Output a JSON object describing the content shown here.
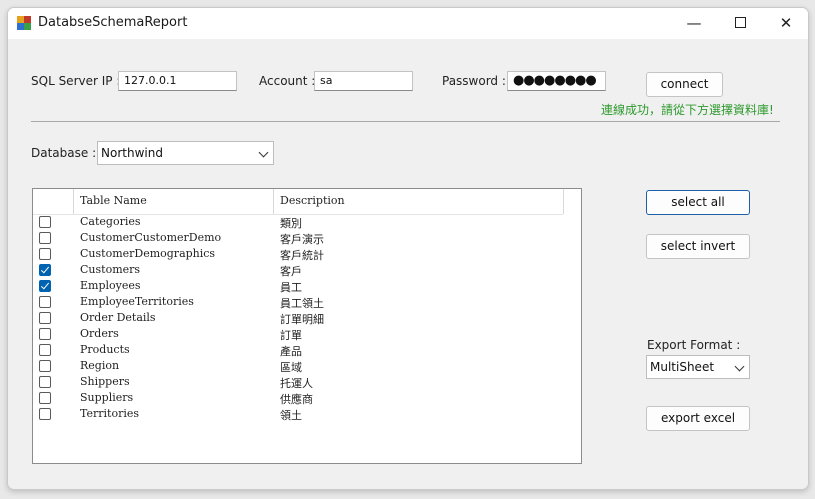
{
  "window": {
    "title": "DatabseSchemaReport",
    "controls": {
      "minimize": "—",
      "close": "✕"
    }
  },
  "connection": {
    "server_label": "SQL Server IP :",
    "server_value": "127.0.0.1",
    "account_label": "Account :",
    "account_value": "sa",
    "password_label": "Password :",
    "password_mask": "●●●●●●●●",
    "connect_label": "connect",
    "status": "連線成功，請從下方選擇資料庫!"
  },
  "database": {
    "label": "Database :",
    "selected": "Northwind"
  },
  "grid": {
    "columns": [
      "Table Name",
      "Description"
    ],
    "rows": [
      {
        "name": "Categories",
        "desc": "類別",
        "checked": false
      },
      {
        "name": "CustomerCustomerDemo",
        "desc": "客戶演示",
        "checked": false
      },
      {
        "name": "CustomerDemographics",
        "desc": "客戶統計",
        "checked": false
      },
      {
        "name": "Customers",
        "desc": "客戶",
        "checked": true
      },
      {
        "name": "Employees",
        "desc": "員工",
        "checked": true
      },
      {
        "name": "EmployeeTerritories",
        "desc": "員工領土",
        "checked": false
      },
      {
        "name": "Order Details",
        "desc": "訂單明細",
        "checked": false
      },
      {
        "name": "Orders",
        "desc": "訂單",
        "checked": false
      },
      {
        "name": "Products",
        "desc": "產品",
        "checked": false
      },
      {
        "name": "Region",
        "desc": "區域",
        "checked": false
      },
      {
        "name": "Shippers",
        "desc": "托運人",
        "checked": false
      },
      {
        "name": "Suppliers",
        "desc": "供應商",
        "checked": false
      },
      {
        "name": "Territories",
        "desc": "領土",
        "checked": false
      }
    ]
  },
  "actions": {
    "select_all": "select all",
    "select_invert": "select invert",
    "export_format_label": "Export Format :",
    "export_format": "MultiSheet",
    "export_excel": "export excel"
  },
  "colors": {
    "accent": "#0063b1",
    "status": "#2e9a2e"
  }
}
